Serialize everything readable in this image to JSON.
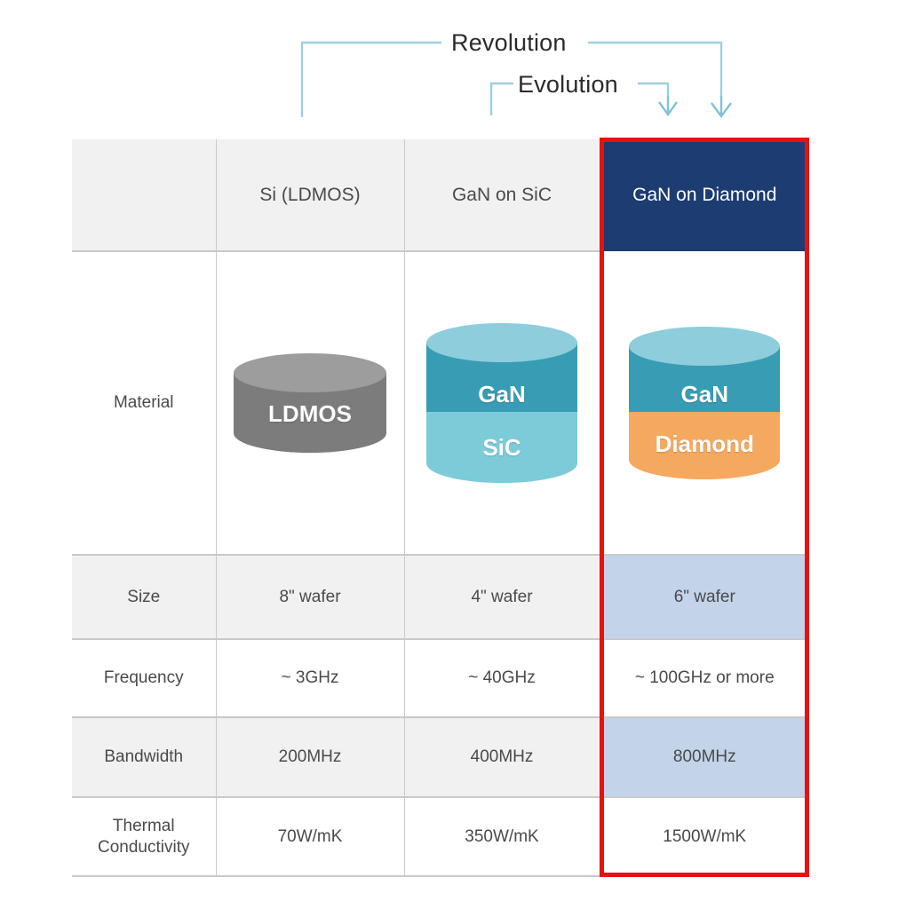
{
  "diagram": {
    "revolution_label": "Revolution",
    "evolution_label": "Evolution",
    "line_color": "#9ecfe0",
    "arrow_color": "#7fc3d8"
  },
  "table": {
    "columns": [
      "",
      "Si (LDMOS)",
      "GaN on SiC",
      "GaN on Diamond"
    ],
    "highlight_column": "GaN on Diamond",
    "highlight_header_bg": "#1c3c72",
    "highlight_cell_bg": "#c3d3ea",
    "highlight_border": "#e8120c",
    "rows": [
      {
        "label": "Material",
        "si": "",
        "gan_sic": "",
        "gan_diamond": ""
      },
      {
        "label": "Size",
        "si": "8\" wafer",
        "gan_sic": "4\" wafer",
        "gan_diamond": "6\" wafer"
      },
      {
        "label": "Frequency",
        "si": "~ 3GHz",
        "gan_sic": "~ 40GHz",
        "gan_diamond": "~ 100GHz or more"
      },
      {
        "label": "Bandwidth",
        "si": "200MHz",
        "gan_sic": "400MHz",
        "gan_diamond": "800MHz"
      },
      {
        "label": "Thermal Conductivity",
        "label_line1": "Thermal",
        "label_line2": "Conductivity",
        "si": "70W/mK",
        "gan_sic": "350W/mK",
        "gan_diamond": "1500W/mK"
      }
    ]
  },
  "cylinders": {
    "ldmos": {
      "label": "LDMOS",
      "body_color": "#7c7c7c",
      "top_color": "#9d9d9d"
    },
    "gan_sic": {
      "top_label": "GaN",
      "bottom_label": "SiC",
      "top_layer_color": "#389cb4",
      "bottom_layer_color": "#7ccbd9",
      "cap_color": "#8ecddb"
    },
    "gan_diamond": {
      "top_label": "GaN",
      "bottom_label": "Diamond",
      "top_layer_color": "#389cb4",
      "bottom_layer_color": "#f5a95f",
      "cap_color": "#8ecddb"
    }
  }
}
